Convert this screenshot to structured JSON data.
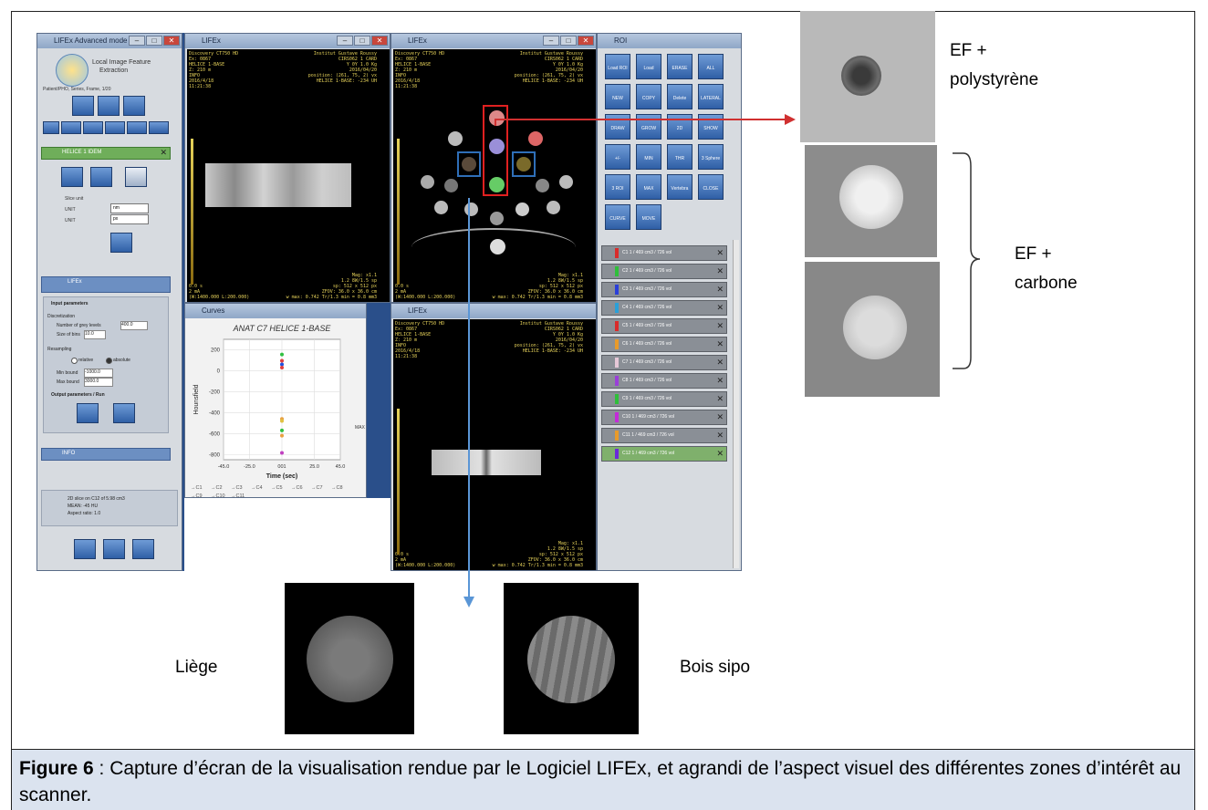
{
  "labels": {
    "ef_poly_line1": "EF +",
    "ef_poly_line2": "polystyrène",
    "ef_carbone_line1": "EF +",
    "ef_carbone_line2": "carbone",
    "liege": "Liège",
    "bois_sipo": "Bois sipo"
  },
  "caption": {
    "figure_label": "Figure 6",
    "text": " : Capture d’écran de la visualisation rendue par le Logiciel LIFEx, et agrandi de l’aspect visuel des différentes zones d’intérêt au scanner."
  },
  "app": {
    "main_window_title": "LIFEx Advanced mode",
    "viewer_title": "LIFEx",
    "roi_window_title": "ROI",
    "app_subtitle_line1": "Local Image Feature",
    "app_subtitle_line2": "Extraction",
    "file_info": "Patient/PHO, Series, Frame, 1/20",
    "tool_buttons": [
      "3D",
      "Seg",
      "Axi",
      "Cor",
      "SG",
      "MM"
    ],
    "top_buttons": [
      "TEXTURE",
      "FILTER",
      "PIXEL"
    ],
    "roi_panel_name": "HELICE 1 IDEM",
    "hist_buttons": [
      "HISTO",
      "MAX",
      "DICM"
    ],
    "select_label1": "Slice unit",
    "select_label2": "UNIT",
    "select_label3": "UNIT",
    "select_val1": "nm",
    "select_val2": "px",
    "move_label": "MOVE",
    "panel_lifex": "LIFEx",
    "input_params": "Input parameters",
    "discretization": "Discretization",
    "num_gray_levels_label": "Number of grey levels",
    "num_gray_levels_value": "400.0",
    "size_bins_label": "Size of bins",
    "size_bins_value": "10.0",
    "resampling": "Resampling",
    "relative_label": "relative",
    "absolute_label": "absolute",
    "min_bound_label": "Min bound",
    "min_bound_value": "-1000.0",
    "max_bound_label": "Max bound",
    "max_bound_value": "3000.0",
    "output_params": "Output parameters / Run",
    "output_btn": "Output Params",
    "run_btn": "RUN",
    "info_panel": "INFO",
    "info_line1": "2D slice on C12 of 5.98 cm3",
    "info_line2": "MEAN: -45 HU",
    "info_line3": "Aspect ratio: 1.0",
    "bottom_buttons": [
      "DIR",
      "PREP",
      "QUIT"
    ],
    "roi_tool_buttons": [
      "Load ROI",
      "Load Bounds",
      "ERASE",
      "ALL",
      "NEW",
      "COPY",
      "Delete",
      "LATERAL",
      "DRAW",
      "GROW",
      "2D",
      "SHOW",
      "+/-",
      "MIN",
      "THR",
      "3 Sphere",
      "3 ROI",
      "MAX",
      "Vertebra",
      "CLOSE",
      "CURVE",
      "MOVE"
    ],
    "roi_rows": [
      {
        "name": "C1",
        "color": "#d92b2b",
        "info": "C1 1 / 469 cm3 / 726 vol"
      },
      {
        "name": "C2",
        "color": "#2fbf3a",
        "info": "C2 1 / 469 cm3 / 726 vol"
      },
      {
        "name": "C3",
        "color": "#2a3fd9",
        "info": "C3 1 / 469 cm3 / 726 vol"
      },
      {
        "name": "C4",
        "color": "#2aa0d9",
        "info": "C4 1 / 469 cm3 / 726 vol"
      },
      {
        "name": "C5",
        "color": "#d92b2b",
        "info": "C5 1 / 469 cm3 / 726 vol"
      },
      {
        "name": "C6",
        "color": "#e89a2a",
        "info": "C6 1 / 469 cm3 / 726 vol"
      },
      {
        "name": "C7",
        "color": "#e6c8d8",
        "info": "C7 1 / 469 cm3 / 726 vol"
      },
      {
        "name": "C8",
        "color": "#9a3fd9",
        "info": "C8 1 / 469 cm3 / 726 vol"
      },
      {
        "name": "C9",
        "color": "#2fbf3a",
        "info": "C9 1 / 469 cm3 / 726 vol"
      },
      {
        "name": "C10",
        "color": "#c42ad9",
        "info": "C10 1 / 469 cm3 / 726 vol"
      },
      {
        "name": "C11",
        "color": "#e89a2a",
        "info": "C11 1 / 469 cm3 / 726 vol"
      },
      {
        "name": "C12",
        "color": "#6a2ad9",
        "info": "C12 1 / 469 cm3 / 726 vol"
      }
    ],
    "viewer_top_left": "Discovery CT750 HD\nEx: 0867\nHELICE 1-BASE\nZ: 210 m\nINFO\n2016/4/18\n11:21:38",
    "viewer_top_right": "Institut Gustave Roussy\nCIRS062 1 CARD\nY 0Y 1.0 Kg\n2016/04/20\nposition: (261, 75, 2) vx\nHELICE 1-BASE: -234 UH",
    "viewer_bottom_left": "0.0 s\n2 mA\n(W:1400.000 L:200.000)",
    "viewer_bottom_right": "Mag: x1.1\n1.2 8W/1.5 sp\nsp: 512 x 512 px\nZFOV: 36.0 x 36.0 cm\nw max: 0.742 Tr/1.3 min = 0.8 mm3",
    "scale_top": "1024",
    "scale_bottom": "-1024"
  },
  "curves": {
    "window_title": "Curves",
    "side_label": "MAX",
    "legend": [
      "C1",
      "C2",
      "C3",
      "C4",
      "C5",
      "C6",
      "C7",
      "C8",
      "C9",
      "C10",
      "C11"
    ]
  },
  "chart_data": {
    "type": "scatter",
    "title": "ANAT C7 HELICE 1-BASE",
    "xlabel": "Time (sec)",
    "ylabel": "Hounsfield",
    "xlim": [
      -45,
      45
    ],
    "ylim": [
      -850,
      300
    ],
    "xticks": [
      "-45.0",
      "-25.0",
      "001",
      "25.0",
      "45.0"
    ],
    "yticks": [
      200,
      0,
      -200,
      -400,
      -600,
      -800
    ],
    "series": [
      {
        "name": "C1",
        "color": "#e04040",
        "points": [
          [
            0,
            95
          ]
        ]
      },
      {
        "name": "C2",
        "color": "#30c040",
        "points": [
          [
            0,
            155
          ]
        ]
      },
      {
        "name": "C3",
        "color": "#2050e0",
        "points": [
          [
            0,
            60
          ]
        ]
      },
      {
        "name": "C5",
        "color": "#e04040",
        "points": [
          [
            0,
            30
          ]
        ]
      },
      {
        "name": "C6",
        "color": "#e8a040",
        "points": [
          [
            0,
            -460
          ]
        ]
      },
      {
        "name": "C7",
        "color": "#e0c040",
        "points": [
          [
            0,
            -480
          ]
        ]
      },
      {
        "name": "C9",
        "color": "#30c040",
        "points": [
          [
            0,
            -570
          ]
        ]
      },
      {
        "name": "C11",
        "color": "#e8a040",
        "points": [
          [
            0,
            -620
          ]
        ]
      },
      {
        "name": "C10",
        "color": "#c040c0",
        "points": [
          [
            0,
            -785
          ]
        ]
      }
    ]
  },
  "colors": {
    "caption_bg": "#dbe3ef",
    "red_box": "#e02020",
    "blue_box": "#2f6fb8",
    "red_arrow": "#d03030",
    "blue_arrow": "#5a96d6"
  }
}
